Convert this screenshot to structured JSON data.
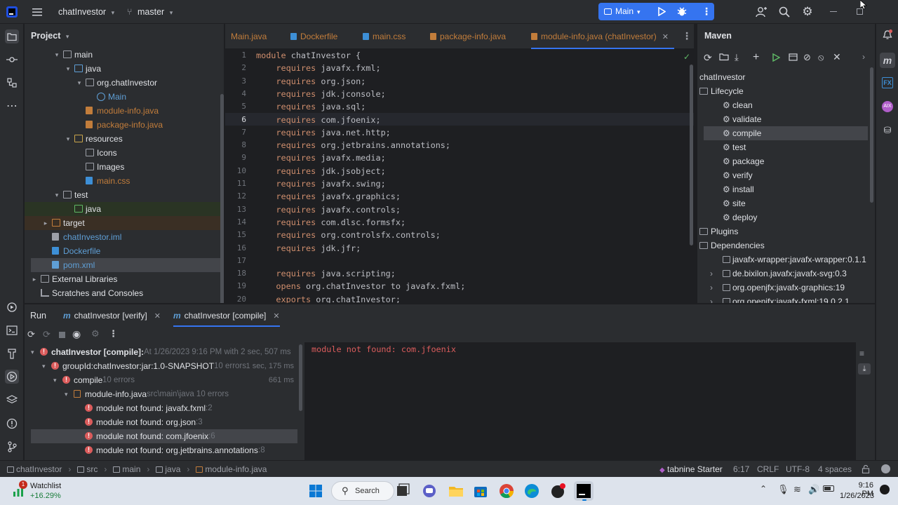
{
  "titlebar": {
    "project_name": "chatInvestor",
    "branch": "master",
    "run_config": "Main"
  },
  "project_panel": {
    "title": "Project",
    "items": [
      {
        "label": "main",
        "indent": 3,
        "arrow": "▾",
        "icon": "folder",
        "color": "#dfe1e5"
      },
      {
        "label": "java",
        "indent": 4,
        "arrow": "▾",
        "icon": "folder-source",
        "color": "#dfe1e5"
      },
      {
        "label": "org.chatInvestor",
        "indent": 5,
        "arrow": "▾",
        "icon": "package",
        "color": "#dfe1e5"
      },
      {
        "label": "Main",
        "indent": 6,
        "arrow": "",
        "icon": "class",
        "color": "#5f9fd6"
      },
      {
        "label": "module-info.java",
        "indent": 5,
        "arrow": "",
        "icon": "java-file",
        "color": "#c27d3b"
      },
      {
        "label": "package-info.java",
        "indent": 5,
        "arrow": "",
        "icon": "java-file",
        "color": "#c27d3b"
      },
      {
        "label": "resources",
        "indent": 4,
        "arrow": "▾",
        "icon": "folder-resources",
        "color": "#dfe1e5"
      },
      {
        "label": "Icons",
        "indent": 5,
        "arrow": "",
        "icon": "folder",
        "color": "#dfe1e5"
      },
      {
        "label": "Images",
        "indent": 5,
        "arrow": "",
        "icon": "folder",
        "color": "#dfe1e5"
      },
      {
        "label": "main.css",
        "indent": 5,
        "arrow": "",
        "icon": "css-file",
        "color": "#c27d3b"
      },
      {
        "label": "test",
        "indent": 3,
        "arrow": "▾",
        "icon": "folder",
        "color": "#dfe1e5"
      },
      {
        "label": "java",
        "indent": 4,
        "arrow": "",
        "icon": "folder-test",
        "color": "#dfe1e5"
      },
      {
        "label": "target",
        "indent": 2,
        "arrow": "▸",
        "icon": "folder-excluded",
        "color": "#dfe1e5"
      },
      {
        "label": "chatInvestor.iml",
        "indent": 2,
        "arrow": "",
        "icon": "iml-file",
        "color": "#5f9fd6"
      },
      {
        "label": "Dockerfile",
        "indent": 2,
        "arrow": "",
        "icon": "docker-file",
        "color": "#5f9fd6"
      },
      {
        "label": "pom.xml",
        "indent": 2,
        "arrow": "",
        "icon": "maven-file",
        "color": "#5f9fd6"
      },
      {
        "label": "External Libraries",
        "indent": 1,
        "arrow": "▸",
        "icon": "library",
        "color": "#dfe1e5"
      },
      {
        "label": "Scratches and Consoles",
        "indent": 1,
        "arrow": "",
        "icon": "scratches",
        "color": "#dfe1e5"
      }
    ]
  },
  "editor_tabs": [
    {
      "label": "Main.java",
      "active": false,
      "icon": "class"
    },
    {
      "label": "Dockerfile",
      "active": false,
      "icon": "docker"
    },
    {
      "label": "main.css",
      "active": false,
      "icon": "css"
    },
    {
      "label": "package-info.java",
      "active": false,
      "icon": "java"
    },
    {
      "label": "module-info.java (chatInvestor)",
      "active": true,
      "icon": "java"
    }
  ],
  "code_lines": [
    {
      "n": "1",
      "pre": "",
      "kw": "module",
      "post": " chatInvestor {"
    },
    {
      "n": "2",
      "pre": "    ",
      "kw": "requires",
      "post": " javafx.fxml;"
    },
    {
      "n": "3",
      "pre": "    ",
      "kw": "requires",
      "post": " org.json;"
    },
    {
      "n": "4",
      "pre": "    ",
      "kw": "requires",
      "post": " jdk.jconsole;"
    },
    {
      "n": "5",
      "pre": "    ",
      "kw": "requires",
      "post": " java.sql;"
    },
    {
      "n": "6",
      "pre": "    ",
      "kw": "requires",
      "post": " com.jfoenix;"
    },
    {
      "n": "7",
      "pre": "    ",
      "kw": "requires",
      "post": " java.net.http;"
    },
    {
      "n": "8",
      "pre": "    ",
      "kw": "requires",
      "post": " org.jetbrains.annotations;"
    },
    {
      "n": "9",
      "pre": "    ",
      "kw": "requires",
      "post": " javafx.media;"
    },
    {
      "n": "10",
      "pre": "    ",
      "kw": "requires",
      "post": " jdk.jsobject;"
    },
    {
      "n": "11",
      "pre": "    ",
      "kw": "requires",
      "post": " javafx.swing;"
    },
    {
      "n": "12",
      "pre": "    ",
      "kw": "requires",
      "post": " javafx.graphics;"
    },
    {
      "n": "13",
      "pre": "    ",
      "kw": "requires",
      "post": " javafx.controls;"
    },
    {
      "n": "14",
      "pre": "    ",
      "kw": "requires",
      "post": " com.dlsc.formsfx;"
    },
    {
      "n": "15",
      "pre": "    ",
      "kw": "requires",
      "post": " org.controlsfx.controls;"
    },
    {
      "n": "16",
      "pre": "    ",
      "kw": "requires",
      "post": " jdk.jfr;"
    },
    {
      "n": "17",
      "pre": "",
      "kw": "",
      "post": ""
    },
    {
      "n": "18",
      "pre": "    ",
      "kw": "requires",
      "post": " java.scripting;"
    },
    {
      "n": "19",
      "pre": "    ",
      "kw": "opens",
      "post": " org.chatInvestor to javafx.fxml;"
    },
    {
      "n": "20",
      "pre": "    ",
      "kw": "exports",
      "post": " org.chatInvestor;"
    }
  ],
  "maven": {
    "title": "Maven",
    "items": [
      {
        "label": "chatInvestor",
        "indent": 0,
        "arrow": "",
        "icon": "none"
      },
      {
        "label": "Lifecycle",
        "indent": 0,
        "arrow": "",
        "icon": "folder"
      },
      {
        "label": "clean",
        "indent": 1,
        "arrow": "",
        "icon": "gear"
      },
      {
        "label": "validate",
        "indent": 1,
        "arrow": "",
        "icon": "gear"
      },
      {
        "label": "compile",
        "indent": 1,
        "arrow": "",
        "icon": "gear",
        "selected": true
      },
      {
        "label": "test",
        "indent": 1,
        "arrow": "",
        "icon": "gear"
      },
      {
        "label": "package",
        "indent": 1,
        "arrow": "",
        "icon": "gear"
      },
      {
        "label": "verify",
        "indent": 1,
        "arrow": "",
        "icon": "gear"
      },
      {
        "label": "install",
        "indent": 1,
        "arrow": "",
        "icon": "gear"
      },
      {
        "label": "site",
        "indent": 1,
        "arrow": "",
        "icon": "gear"
      },
      {
        "label": "deploy",
        "indent": 1,
        "arrow": "",
        "icon": "gear"
      },
      {
        "label": "Plugins",
        "indent": 0,
        "arrow": "",
        "icon": "folder"
      },
      {
        "label": "Dependencies",
        "indent": 0,
        "arrow": "",
        "icon": "folder"
      },
      {
        "label": "javafx-wrapper:javafx-wrapper:0.1.1",
        "indent": 1,
        "arrow": "",
        "icon": "lib"
      },
      {
        "label": "de.bixilon.javafx:javafx-svg:0.3",
        "indent": 1,
        "arrow": "›",
        "icon": "lib"
      },
      {
        "label": "org.openjfx:javafx-graphics:19",
        "indent": 1,
        "arrow": "›",
        "icon": "lib"
      },
      {
        "label": "org.openjfx:javafx-fxml:19.0.2.1",
        "indent": 1,
        "arrow": "›",
        "icon": "lib"
      }
    ]
  },
  "run": {
    "title": "Run",
    "tabs": [
      {
        "label": "chatInvestor [verify]",
        "active": false
      },
      {
        "label": "chatInvestor [compile]",
        "active": true
      }
    ],
    "tree": [
      {
        "label": "chatInvestor [compile]:",
        "extra": " At 1/26/2023 9:16 PM with 2 sec, 507 ms",
        "time": "",
        "indent": 0,
        "arrow": "▾",
        "icon": "err"
      },
      {
        "label": "groupId:chatInvestor:jar:1.0-SNAPSHOT",
        "extra": " 10 errors",
        "time": "1 sec, 175 ms",
        "indent": 1,
        "arrow": "▾",
        "icon": "err"
      },
      {
        "label": "compile",
        "extra": " 10 errors",
        "time": "661 ms",
        "indent": 2,
        "arrow": "▾",
        "icon": "err"
      },
      {
        "label": "module-info.java",
        "extra": " src\\main\\java 10 errors",
        "time": "",
        "indent": 3,
        "arrow": "▾",
        "icon": "java"
      },
      {
        "label": "module not found: javafx.fxml",
        "extra": " :2",
        "time": "",
        "indent": 4,
        "arrow": "",
        "icon": "err"
      },
      {
        "label": "module not found: org.json",
        "extra": " :3",
        "time": "",
        "indent": 4,
        "arrow": "",
        "icon": "err"
      },
      {
        "label": "module not found: com.jfoenix",
        "extra": " :6",
        "time": "",
        "indent": 4,
        "arrow": "",
        "icon": "err",
        "selected": true
      },
      {
        "label": "module not found: org.jetbrains.annotations",
        "extra": " :8",
        "time": "",
        "indent": 4,
        "arrow": "",
        "icon": "err"
      }
    ],
    "output": "module not found: com.jfoenix"
  },
  "statusbar": {
    "breadcrumb": [
      "chatInvestor",
      "src",
      "main",
      "java",
      "module-info.java"
    ],
    "plugin": "tabnine Starter",
    "position": "6:17",
    "line_sep": "CRLF",
    "encoding": "UTF-8",
    "indent": "4 spaces"
  },
  "taskbar": {
    "widget_title": "Watchlist",
    "widget_value": "+16.29%",
    "widget_badge": "1",
    "search": "Search",
    "time": "9:16 PM",
    "date": "1/26/2023"
  }
}
